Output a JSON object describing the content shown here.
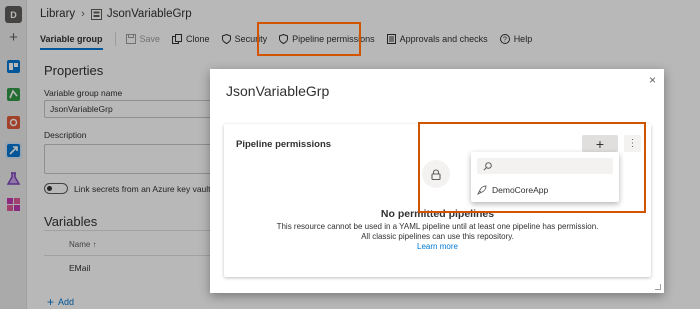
{
  "rail": {
    "org_initial": "D"
  },
  "header": {
    "breadcrumb_root": "Library",
    "breadcrumb_sep": "›",
    "breadcrumb_current": "JsonVariableGrp"
  },
  "toolbar": {
    "tab_variable_group": "Variable group",
    "save": "Save",
    "clone": "Clone",
    "security": "Security",
    "pipeline_permissions": "Pipeline permissions",
    "approvals": "Approvals and checks",
    "help": "Help"
  },
  "properties": {
    "heading": "Properties",
    "name_label": "Variable group name",
    "name_value": "JsonVariableGrp",
    "description_label": "Description",
    "description_value": "",
    "keyvault_label": "Link secrets from an Azure key vault as"
  },
  "variables": {
    "heading": "Variables",
    "column_name": "Name",
    "sort_glyph": "↑",
    "rows": [
      "EMail"
    ],
    "add_label": "Add",
    "add_glyph": "+"
  },
  "dialog": {
    "title": "JsonVariableGrp",
    "close_glyph": "×",
    "card_title": "Pipeline permissions",
    "add_glyph": "+",
    "more_glyph": "⋮",
    "empty_title": "No permitted pipelines",
    "empty_line1": "This resource cannot be used in a YAML pipeline until at least one pipeline has permission.",
    "empty_line2": "All classic pipelines can use this repository.",
    "learn_more": "Learn more"
  },
  "dropdown": {
    "search_value": "",
    "items": [
      "DemoCoreApp"
    ]
  },
  "colors": {
    "accent": "#0078d4",
    "highlight": "#d35400",
    "rail_boards": "#0078d4",
    "rail_repos": "#e05a3b",
    "rail_test": "#339947",
    "rail_artifacts": "#c239b3"
  },
  "icons": [
    "plus-icon",
    "boards-icon",
    "repos-icon",
    "pipelines-icon",
    "test-plans-icon",
    "artifacts-icon",
    "library-icon",
    "save-icon",
    "clone-icon",
    "shield-icon",
    "approvals-icon",
    "help-icon",
    "lock-icon",
    "search-icon",
    "rocket-icon",
    "close-icon"
  ]
}
